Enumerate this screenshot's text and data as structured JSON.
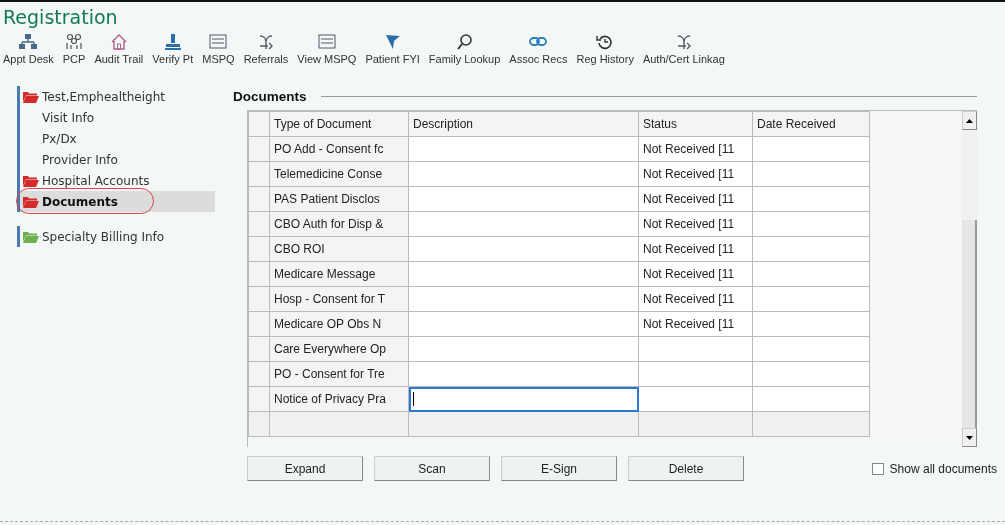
{
  "window": {
    "title": "Registration"
  },
  "toolbar": [
    {
      "label": "Appt Desk"
    },
    {
      "label": "PCP"
    },
    {
      "label": "Audit Trail"
    },
    {
      "label": "Verify Pt"
    },
    {
      "label": "MSPQ"
    },
    {
      "label": "Referrals"
    },
    {
      "label": "View MSPQ"
    },
    {
      "label": "Patient FYI"
    },
    {
      "label": "Family Lookup"
    },
    {
      "label": "Assoc Recs"
    },
    {
      "label": "Reg History"
    },
    {
      "label": "Auth/Cert Linkag"
    }
  ],
  "sidebar": {
    "items": [
      {
        "label": "Test,Emphealtheight",
        "color": "#d42a2a",
        "selected": false,
        "children": [
          {
            "label": "Visit Info",
            "selected": false
          },
          {
            "label": "Px/Dx",
            "selected": false
          },
          {
            "label": "Provider Info",
            "selected": false
          }
        ]
      },
      {
        "label": "Hospital Accounts",
        "color": "#d42a2a",
        "selected": false
      },
      {
        "label": "Documents",
        "color": "#d42a2a",
        "selected": true
      },
      {
        "label": "Specialty Billing Info",
        "color": "#6ab04c",
        "selected": false
      }
    ]
  },
  "documents": {
    "title": "Documents",
    "table": {
      "columns": [
        "Type of Document",
        "Description",
        "Status",
        "Date Received"
      ],
      "rows": [
        {
          "type": "PO Add - Consent fc",
          "status": "Not Received [11",
          "editing": false
        },
        {
          "type": "Telemedicine Conse",
          "status": "Not Received [11",
          "editing": false
        },
        {
          "type": "PAS Patient Disclos",
          "status": "Not Received [11",
          "editing": false
        },
        {
          "type": "CBO Auth for Disp &",
          "status": "Not Received [11",
          "editing": false
        },
        {
          "type": "CBO ROI",
          "status": "Not Received [11",
          "editing": false
        },
        {
          "type": "Medicare Message",
          "status": "Not Received [11",
          "editing": false
        },
        {
          "type": "Hosp - Consent for T",
          "status": "Not Received [11",
          "editing": false
        },
        {
          "type": "Medicare OP Obs N",
          "status": "Not Received [11",
          "editing": false
        },
        {
          "type": "Care Everywhere Op",
          "editing": false
        },
        {
          "type": "PO - Consent for Tre",
          "editing": false
        },
        {
          "type": "Notice of Privacy Pra",
          "editing": true
        }
      ]
    },
    "buttons": [
      {
        "label": "Expand"
      },
      {
        "label": "Scan"
      },
      {
        "label": "E-Sign"
      },
      {
        "label": "Delete"
      }
    ],
    "show_all": {
      "label": "Show all documents",
      "checked": false
    }
  }
}
